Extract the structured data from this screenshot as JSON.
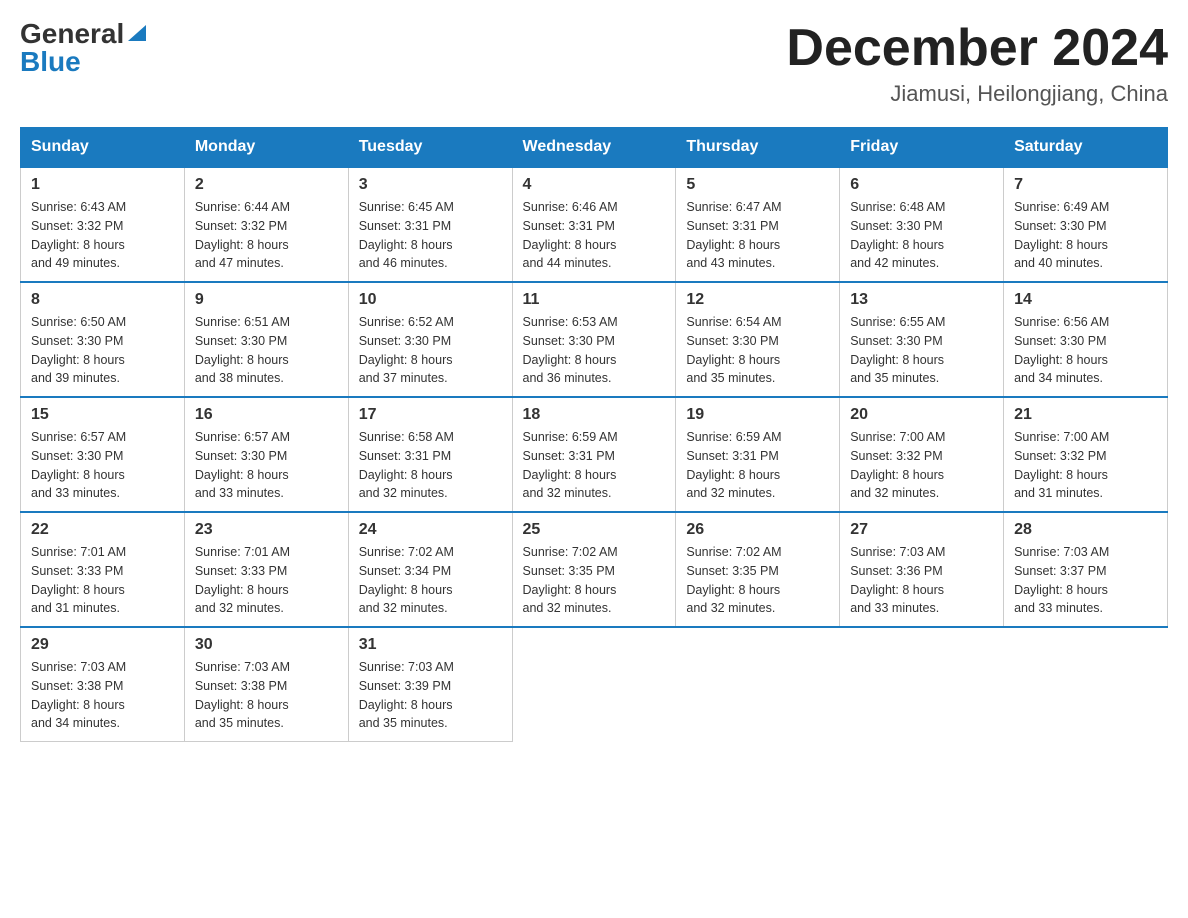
{
  "header": {
    "logo_general": "General",
    "logo_blue": "Blue",
    "month_title": "December 2024",
    "location": "Jiamusi, Heilongjiang, China"
  },
  "weekdays": [
    "Sunday",
    "Monday",
    "Tuesday",
    "Wednesday",
    "Thursday",
    "Friday",
    "Saturday"
  ],
  "weeks": [
    [
      {
        "day": "1",
        "info": "Sunrise: 6:43 AM\nSunset: 3:32 PM\nDaylight: 8 hours\nand 49 minutes."
      },
      {
        "day": "2",
        "info": "Sunrise: 6:44 AM\nSunset: 3:32 PM\nDaylight: 8 hours\nand 47 minutes."
      },
      {
        "day": "3",
        "info": "Sunrise: 6:45 AM\nSunset: 3:31 PM\nDaylight: 8 hours\nand 46 minutes."
      },
      {
        "day": "4",
        "info": "Sunrise: 6:46 AM\nSunset: 3:31 PM\nDaylight: 8 hours\nand 44 minutes."
      },
      {
        "day": "5",
        "info": "Sunrise: 6:47 AM\nSunset: 3:31 PM\nDaylight: 8 hours\nand 43 minutes."
      },
      {
        "day": "6",
        "info": "Sunrise: 6:48 AM\nSunset: 3:30 PM\nDaylight: 8 hours\nand 42 minutes."
      },
      {
        "day": "7",
        "info": "Sunrise: 6:49 AM\nSunset: 3:30 PM\nDaylight: 8 hours\nand 40 minutes."
      }
    ],
    [
      {
        "day": "8",
        "info": "Sunrise: 6:50 AM\nSunset: 3:30 PM\nDaylight: 8 hours\nand 39 minutes."
      },
      {
        "day": "9",
        "info": "Sunrise: 6:51 AM\nSunset: 3:30 PM\nDaylight: 8 hours\nand 38 minutes."
      },
      {
        "day": "10",
        "info": "Sunrise: 6:52 AM\nSunset: 3:30 PM\nDaylight: 8 hours\nand 37 minutes."
      },
      {
        "day": "11",
        "info": "Sunrise: 6:53 AM\nSunset: 3:30 PM\nDaylight: 8 hours\nand 36 minutes."
      },
      {
        "day": "12",
        "info": "Sunrise: 6:54 AM\nSunset: 3:30 PM\nDaylight: 8 hours\nand 35 minutes."
      },
      {
        "day": "13",
        "info": "Sunrise: 6:55 AM\nSunset: 3:30 PM\nDaylight: 8 hours\nand 35 minutes."
      },
      {
        "day": "14",
        "info": "Sunrise: 6:56 AM\nSunset: 3:30 PM\nDaylight: 8 hours\nand 34 minutes."
      }
    ],
    [
      {
        "day": "15",
        "info": "Sunrise: 6:57 AM\nSunset: 3:30 PM\nDaylight: 8 hours\nand 33 minutes."
      },
      {
        "day": "16",
        "info": "Sunrise: 6:57 AM\nSunset: 3:30 PM\nDaylight: 8 hours\nand 33 minutes."
      },
      {
        "day": "17",
        "info": "Sunrise: 6:58 AM\nSunset: 3:31 PM\nDaylight: 8 hours\nand 32 minutes."
      },
      {
        "day": "18",
        "info": "Sunrise: 6:59 AM\nSunset: 3:31 PM\nDaylight: 8 hours\nand 32 minutes."
      },
      {
        "day": "19",
        "info": "Sunrise: 6:59 AM\nSunset: 3:31 PM\nDaylight: 8 hours\nand 32 minutes."
      },
      {
        "day": "20",
        "info": "Sunrise: 7:00 AM\nSunset: 3:32 PM\nDaylight: 8 hours\nand 32 minutes."
      },
      {
        "day": "21",
        "info": "Sunrise: 7:00 AM\nSunset: 3:32 PM\nDaylight: 8 hours\nand 31 minutes."
      }
    ],
    [
      {
        "day": "22",
        "info": "Sunrise: 7:01 AM\nSunset: 3:33 PM\nDaylight: 8 hours\nand 31 minutes."
      },
      {
        "day": "23",
        "info": "Sunrise: 7:01 AM\nSunset: 3:33 PM\nDaylight: 8 hours\nand 32 minutes."
      },
      {
        "day": "24",
        "info": "Sunrise: 7:02 AM\nSunset: 3:34 PM\nDaylight: 8 hours\nand 32 minutes."
      },
      {
        "day": "25",
        "info": "Sunrise: 7:02 AM\nSunset: 3:35 PM\nDaylight: 8 hours\nand 32 minutes."
      },
      {
        "day": "26",
        "info": "Sunrise: 7:02 AM\nSunset: 3:35 PM\nDaylight: 8 hours\nand 32 minutes."
      },
      {
        "day": "27",
        "info": "Sunrise: 7:03 AM\nSunset: 3:36 PM\nDaylight: 8 hours\nand 33 minutes."
      },
      {
        "day": "28",
        "info": "Sunrise: 7:03 AM\nSunset: 3:37 PM\nDaylight: 8 hours\nand 33 minutes."
      }
    ],
    [
      {
        "day": "29",
        "info": "Sunrise: 7:03 AM\nSunset: 3:38 PM\nDaylight: 8 hours\nand 34 minutes."
      },
      {
        "day": "30",
        "info": "Sunrise: 7:03 AM\nSunset: 3:38 PM\nDaylight: 8 hours\nand 35 minutes."
      },
      {
        "day": "31",
        "info": "Sunrise: 7:03 AM\nSunset: 3:39 PM\nDaylight: 8 hours\nand 35 minutes."
      },
      null,
      null,
      null,
      null
    ]
  ]
}
